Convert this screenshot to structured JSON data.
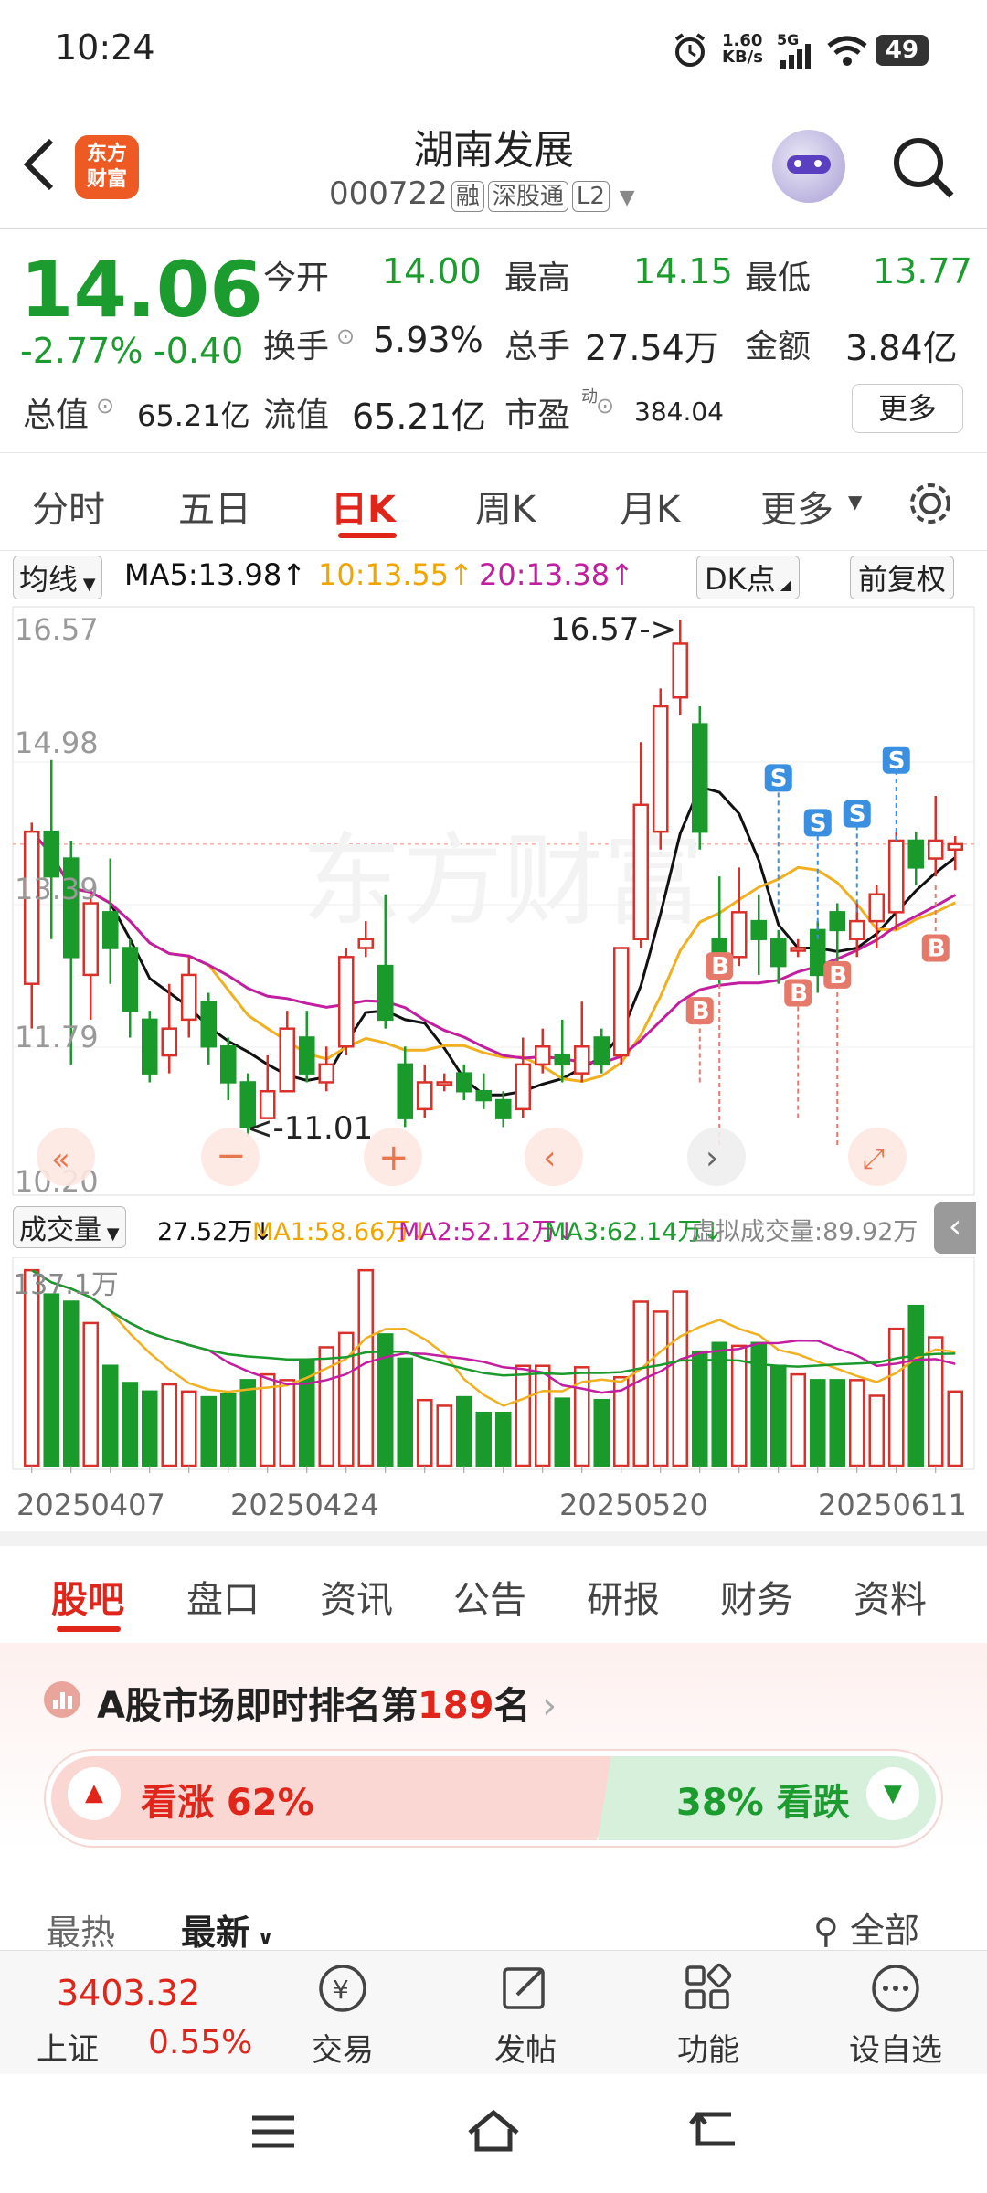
{
  "status_bar": {
    "time": "10:24",
    "net_speed_top": "1.60",
    "net_speed_unit": "KB/s",
    "signal": "5G",
    "battery": "49"
  },
  "header": {
    "title": "湖南发展",
    "code": "000722",
    "tags": [
      "融",
      "深股通",
      "L2"
    ],
    "logo_text_1": "东方",
    "logo_text_2": "财富"
  },
  "quote": {
    "price": "14.06",
    "change_pct": "-2.77%",
    "change": "-0.40",
    "open_label": "今开",
    "open": "14.00",
    "high_label": "最高",
    "high": "14.15",
    "low_label": "最低",
    "low": "13.77",
    "turnover_label": "换手",
    "turnover": "5.93%",
    "volume_label": "总手",
    "volume": "27.54万",
    "amount_label": "金额",
    "amount": "3.84亿",
    "mktcap_label": "总值",
    "mktcap": "65.21亿",
    "float_label": "流值",
    "float": "65.21亿",
    "pe_label": "市盈",
    "pe_sup": "动",
    "pe": "384.04",
    "more_button": "更多"
  },
  "period_tabs": [
    "分时",
    "五日",
    "日K",
    "周K",
    "月K",
    "更多"
  ],
  "active_tab": "日K",
  "ma_bar": {
    "selector": "均线",
    "ma5": "MA5:13.98",
    "ma10": "10:13.55",
    "ma20": "20:13.38",
    "dk": "DK点",
    "fq": "前复权"
  },
  "kline": {
    "y_labels": [
      "16.57",
      "14.98",
      "13.39",
      "11.79",
      "10.20"
    ],
    "high_marker": "16.57->",
    "low_marker": "<-11.01"
  },
  "volume_bar": {
    "selector": "成交量",
    "vol": "27.52万",
    "ma1": "MA1:58.66万",
    "ma2": "MA2:52.12万",
    "ma3": "MA3:62.14万",
    "virtual": "虚拟成交量:89.92万",
    "max_label": "137.1万"
  },
  "dates": [
    "20250407",
    "20250424",
    "20250520",
    "20250611"
  ],
  "content_tabs": [
    "股吧",
    "盘口",
    "资讯",
    "公告",
    "研报",
    "财务",
    "资料"
  ],
  "active_content_tab": "股吧",
  "ranking": {
    "prefix": "A股市场即时排名第",
    "rank": "189",
    "suffix": "名"
  },
  "sentiment": {
    "bull": "看涨 62%",
    "bear": "38% 看跌",
    "bull_pct": 62
  },
  "sort": {
    "hot": "最热",
    "new": "最新",
    "all": "全部"
  },
  "bottom_nav": {
    "index_value": "3403.32",
    "index_name": "上证",
    "index_change": "0.55%",
    "trade": "交易",
    "post": "发帖",
    "func": "功能",
    "watch": "设自选"
  },
  "chart_data": {
    "type": "candlestick",
    "candles_ohlc": [
      [
        12.5,
        14.2,
        12.0,
        14.3
      ],
      [
        14.2,
        13.7,
        13.0,
        15.0
      ],
      [
        13.9,
        12.8,
        11.6,
        14.1
      ],
      [
        12.6,
        13.4,
        12.1,
        13.5
      ],
      [
        13.3,
        12.9,
        12.5,
        13.9
      ],
      [
        12.9,
        12.2,
        11.9,
        13.0
      ],
      [
        12.1,
        11.5,
        11.4,
        12.2
      ],
      [
        11.7,
        12.0,
        11.5,
        12.5
      ],
      [
        12.1,
        12.6,
        11.9,
        12.8
      ],
      [
        12.3,
        11.8,
        11.6,
        12.4
      ],
      [
        11.8,
        11.4,
        11.2,
        11.9
      ],
      [
        11.4,
        10.9,
        10.8,
        11.5
      ],
      [
        11.0,
        11.3,
        11.0,
        11.7
      ],
      [
        11.3,
        12.0,
        11.3,
        12.2
      ],
      [
        11.9,
        11.5,
        11.4,
        12.2
      ],
      [
        11.4,
        11.6,
        11.3,
        11.8
      ],
      [
        11.8,
        12.8,
        11.7,
        12.9
      ],
      [
        12.9,
        13.0,
        12.8,
        13.2
      ],
      [
        12.7,
        12.1,
        12.0,
        13.5
      ],
      [
        11.6,
        11.0,
        10.9,
        11.8
      ],
      [
        11.1,
        11.4,
        11.0,
        11.6
      ],
      [
        11.4,
        11.4,
        11.3,
        11.5
      ],
      [
        11.5,
        11.3,
        11.2,
        11.6
      ],
      [
        11.3,
        11.2,
        11.1,
        11.5
      ],
      [
        11.2,
        11.0,
        10.9,
        11.3
      ],
      [
        11.1,
        11.6,
        11.0,
        11.9
      ],
      [
        11.6,
        11.8,
        11.5,
        12.0
      ],
      [
        11.7,
        11.6,
        11.4,
        12.1
      ],
      [
        11.5,
        11.8,
        11.4,
        12.3
      ],
      [
        11.9,
        11.6,
        11.5,
        12.0
      ],
      [
        11.7,
        12.9,
        11.6,
        12.9
      ],
      [
        13.0,
        14.5,
        12.9,
        15.2
      ],
      [
        14.2,
        15.6,
        14.0,
        15.8
      ],
      [
        15.7,
        16.3,
        15.5,
        16.57
      ],
      [
        15.4,
        14.2,
        14.0,
        15.6
      ],
      [
        13.0,
        12.6,
        12.5,
        13.7
      ],
      [
        12.8,
        13.3,
        12.7,
        13.8
      ],
      [
        13.2,
        13.0,
        12.6,
        13.5
      ],
      [
        13.0,
        12.7,
        12.5,
        13.1
      ],
      [
        12.9,
        12.9,
        12.8,
        13.0
      ],
      [
        13.1,
        12.6,
        12.4,
        13.2
      ],
      [
        13.3,
        13.1,
        12.7,
        13.4
      ],
      [
        13.0,
        13.2,
        12.8,
        13.4
      ],
      [
        13.2,
        13.5,
        12.9,
        13.6
      ],
      [
        13.3,
        14.1,
        13.1,
        14.2
      ],
      [
        14.1,
        13.8,
        13.6,
        14.2
      ],
      [
        13.9,
        14.1,
        13.7,
        14.6
      ],
      [
        14.0,
        14.06,
        13.77,
        14.15
      ]
    ],
    "volume_wan": [
      137,
      120,
      115,
      100,
      70,
      58,
      52,
      57,
      52,
      48,
      50,
      60,
      64,
      60,
      74,
      83,
      93,
      137,
      92,
      75,
      46,
      42,
      48,
      37,
      37,
      70,
      70,
      47,
      69,
      46,
      62,
      115,
      108,
      122,
      80,
      86,
      84,
      86,
      70,
      64,
      60,
      60,
      60,
      49,
      96,
      112,
      90,
      52
    ],
    "ylim": [
      10.2,
      16.57
    ],
    "y_tick_labels": [
      "16.57",
      "14.98",
      "13.39",
      "11.79",
      "10.20"
    ],
    "x_tick_labels": [
      "20250407",
      "20250424",
      "20250520",
      "20250611"
    ]
  }
}
